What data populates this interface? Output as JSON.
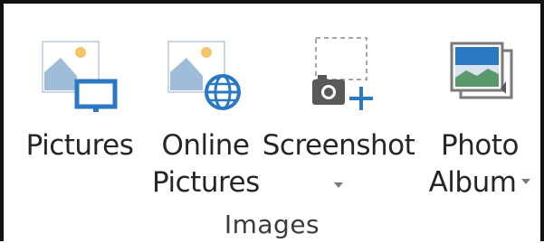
{
  "group": {
    "label": "Images"
  },
  "buttons": {
    "pictures": {
      "line1": "Pictures",
      "icon": "pictures-icon"
    },
    "online_pictures": {
      "line1": "Online",
      "line2": "Pictures",
      "icon": "online-pictures-icon"
    },
    "screenshot": {
      "line1": "Screenshot",
      "icon": "screenshot-icon",
      "has_dropdown": true
    },
    "photo_album": {
      "line1": "Photo",
      "line2": "Album",
      "icon": "photo-album-icon",
      "has_dropdown": true
    }
  },
  "colors": {
    "accent_blue": "#2b79c2",
    "picture_sky": "#d6e3ef",
    "picture_mountain": "#9fbcd9",
    "sun": "#f5c36b",
    "camera": "#595959",
    "album_green": "#5a9a6a"
  }
}
